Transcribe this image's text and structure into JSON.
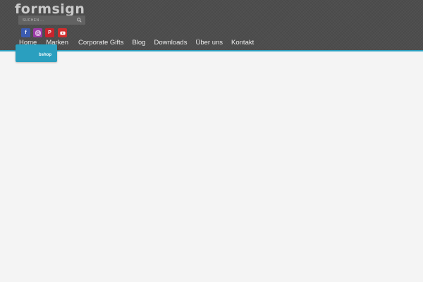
{
  "brand": {
    "logo_text": "formsign"
  },
  "search": {
    "placeholder": "SUCHEN ...",
    "icon": "search-icon"
  },
  "social": [
    {
      "name": "facebook",
      "glyph": "f",
      "color": "#3b5bb0"
    },
    {
      "name": "instagram",
      "glyph": "◎",
      "color": "#9b3aa6"
    },
    {
      "name": "pinterest",
      "glyph": "P",
      "color": "#c8232c"
    },
    {
      "name": "youtube",
      "glyph": "▶",
      "color": "#d12e2e"
    }
  ],
  "nav": {
    "items": [
      {
        "label": "Home"
      },
      {
        "label": "Marken"
      },
      {
        "label": "Corporate Gifts"
      },
      {
        "label": "Blog"
      },
      {
        "label": "Downloads"
      },
      {
        "label": "Über uns"
      },
      {
        "label": "Kontakt"
      }
    ],
    "dropdown_item": "bshop"
  },
  "colors": {
    "header_bg": "#4d4d4d",
    "accent": "#2a9fbf",
    "page_bg": "#f4f4f4"
  }
}
